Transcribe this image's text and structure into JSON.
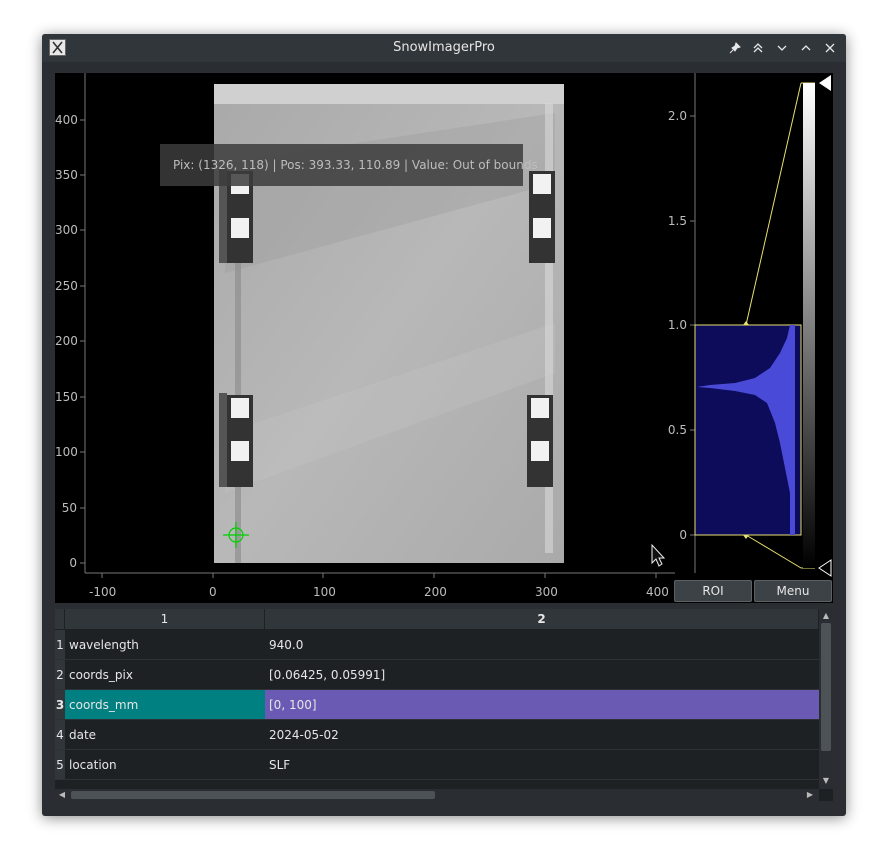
{
  "window": {
    "title": "SnowImagerPro"
  },
  "titlebar_buttons": [
    {
      "name": "pin-icon",
      "glyph": "📌"
    },
    {
      "name": "keep-above-icon",
      "glyph": "⌃"
    },
    {
      "name": "minimize-icon",
      "glyph": "⌄"
    },
    {
      "name": "maximize-icon",
      "glyph": "⌃"
    },
    {
      "name": "close-icon",
      "glyph": "✕"
    }
  ],
  "image_view": {
    "position_readout": "Pix: (1326, 118) | Pos: 393.33, 110.89 | Value: Out of bounds",
    "x_ticks": [
      "-100",
      "0",
      "100",
      "200",
      "300",
      "400"
    ],
    "y_ticks": [
      "0",
      "50",
      "100",
      "150",
      "200",
      "250",
      "300",
      "350",
      "400"
    ]
  },
  "histogram": {
    "y_ticks": [
      "0",
      "0.5",
      "1.0",
      "1.5",
      "2.0"
    ],
    "roi_button": "ROI",
    "menu_button": "Menu",
    "colors": {
      "fill": "#0c0c5a",
      "curve": "#4a4ad8",
      "level_line": "#e8e070"
    }
  },
  "table": {
    "columns": [
      "1",
      "2"
    ],
    "rows": [
      {
        "num": "1",
        "key": "wavelength",
        "value": "940.0"
      },
      {
        "num": "2",
        "key": "coords_pix",
        "value": "[0.06425, 0.05991]"
      },
      {
        "num": "3",
        "key": "coords_mm",
        "value": "[0, 100]"
      },
      {
        "num": "4",
        "key": "date",
        "value": "2024-05-02"
      },
      {
        "num": "5",
        "key": "location",
        "value": "SLF"
      }
    ],
    "selected_row": 3,
    "colors": {
      "selected_key_bg": "#008080",
      "selected_value_bg": "#6a5ab4"
    }
  }
}
